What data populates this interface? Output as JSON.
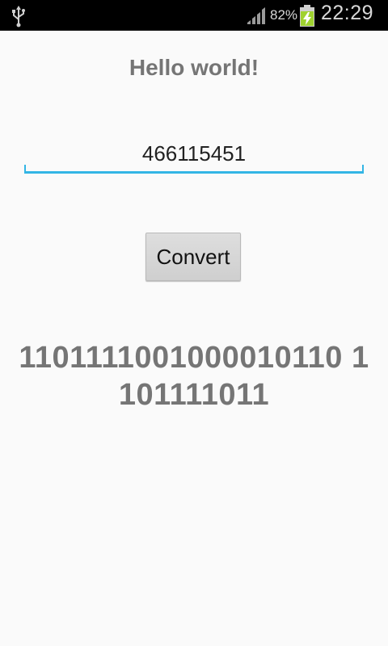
{
  "status_bar": {
    "battery_percent": "82%",
    "time": "22:29",
    "icons": [
      "usb-icon",
      "signal-icon",
      "battery-charging-icon"
    ]
  },
  "app": {
    "title": "Hello world!",
    "input": {
      "value": "466115451"
    },
    "convert_label": "Convert",
    "result_binary": "1101111001000010110 1101111011"
  },
  "colors": {
    "accent": "#33b5e5",
    "text_gray": "#757575",
    "background": "#fafafa",
    "status_bar": "#000000"
  }
}
